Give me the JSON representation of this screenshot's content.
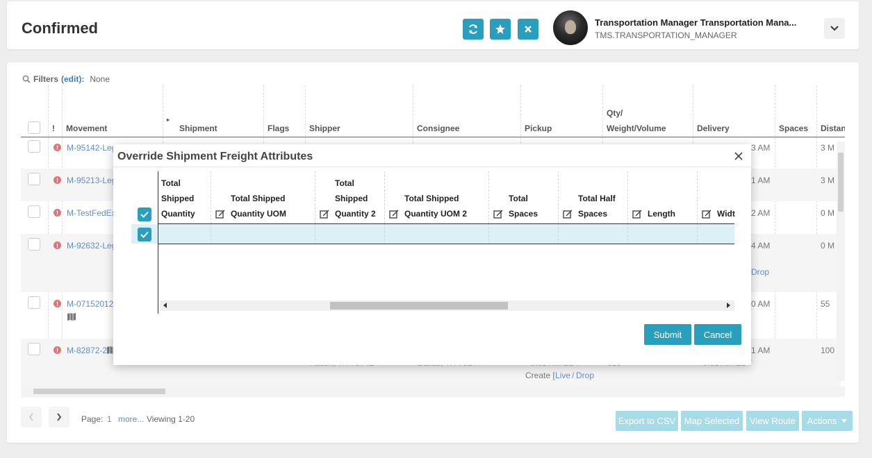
{
  "header": {
    "title": "Confirmed",
    "user_name": "Transportation Manager Transportation Mana...",
    "user_role": "TMS.TRANSPORTATION_MANAGER"
  },
  "filters": {
    "label": "Filters",
    "edit": "(edit):",
    "value": "None"
  },
  "grid": {
    "columns": [
      "!",
      "Movement",
      "Shipment",
      "Flags",
      "Shipper",
      "Consignee",
      "Pickup",
      "Qty/",
      "Weight/Volume",
      "Delivery",
      "Spaces",
      "Distan"
    ],
    "rows": [
      {
        "movement": "M-95142-Leg",
        "delivery": "3 AM",
        "distance": "3 M"
      },
      {
        "movement": "M-95213-Leg",
        "delivery": "1 AM",
        "distance": "3 M"
      },
      {
        "movement": "M-TestFedEx",
        "delivery": "2 AM",
        "distance": "0 M"
      },
      {
        "movement": "M-92632-Leg",
        "delivery": "4 AM",
        "delivery2": "Drop",
        "distance": "0 M"
      },
      {
        "movement": "M-071520120",
        "delivery": "0 AM",
        "distance": "55"
      },
      {
        "movement": "M-82872-2",
        "delivery": "1 AM",
        "distance": "100",
        "shipper": "Austin, TX 78741",
        "consignee": "Dallas, TX 75244",
        "pickup": "- 5:31 AM EDT",
        "qty": "010",
        "delivery_time": "- 5:31 AM EDT",
        "create": "Create [",
        "live": "Live",
        "slash": "/",
        "drop": "Drop"
      }
    ]
  },
  "pager": {
    "page_label": "Page:",
    "page_num": "1",
    "more": "more...",
    "viewing": "Viewing 1-20"
  },
  "actions": {
    "export": "Export to CSV",
    "map_selected": "Map Selected",
    "view_route": "View Route",
    "actions": "Actions"
  },
  "modal": {
    "title": "Override Shipment Freight Attributes",
    "columns": [
      {
        "line1": "Total",
        "line2": "Shipped",
        "line3": "Quantity",
        "editable": false
      },
      {
        "line1": "",
        "line2": "Total Shipped",
        "line3": "Quantity UOM",
        "editable": true
      },
      {
        "line1": "Total",
        "line2": "Shipped",
        "line3": "Quantity 2",
        "editable": true
      },
      {
        "line1": "",
        "line2": "Total Shipped",
        "line3": "Quantity UOM 2",
        "editable": true
      },
      {
        "line1": "",
        "line2": "Total",
        "line3": "Spaces",
        "editable": true
      },
      {
        "line1": "",
        "line2": "Total Half",
        "line3": "Spaces",
        "editable": true
      },
      {
        "line1": "",
        "line2": "",
        "line3": "Length",
        "editable": true
      },
      {
        "line1": "",
        "line2": "",
        "line3": "Widt",
        "editable": true
      }
    ],
    "submit": "Submit",
    "cancel": "Cancel"
  },
  "colors": {
    "accent": "#2a9ebd",
    "link": "#5b8fd0",
    "warning": "#e57373",
    "disabled_button": "#a6dbe8"
  }
}
